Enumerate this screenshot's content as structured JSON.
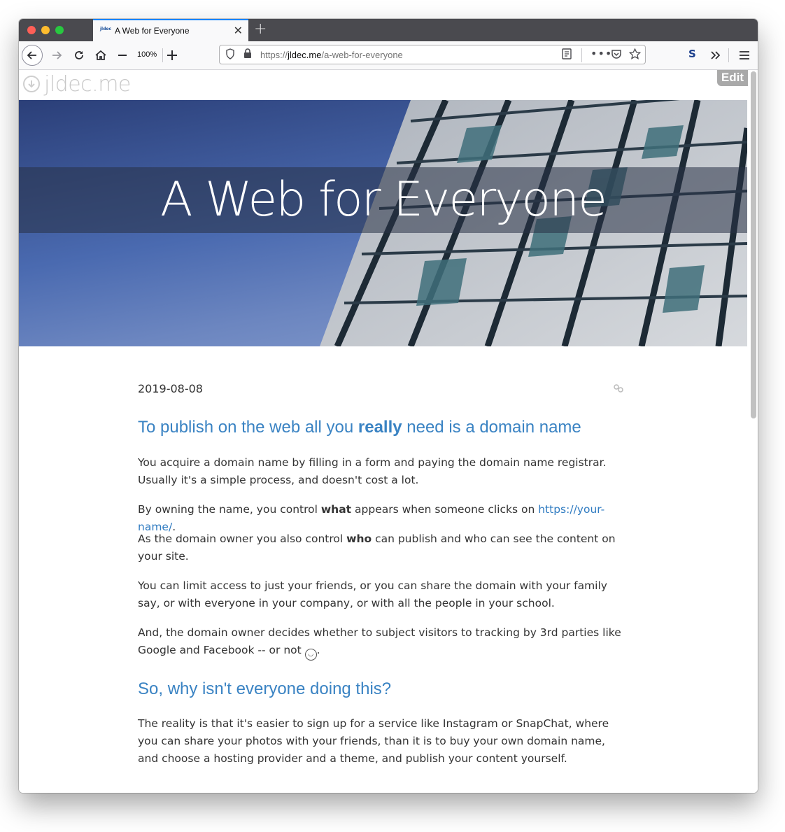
{
  "browser": {
    "tab_favicon": "jldec",
    "tab_title": "A Web for Everyone",
    "zoom": "100%",
    "url_prefix": "https://",
    "url_host": "jldec.me",
    "url_path": "/a-web-for-everyone",
    "ext_label": "S",
    "accent_color": "#0a84ff"
  },
  "site": {
    "name": "jldec.me",
    "edit_label": "Edit"
  },
  "hero": {
    "title": "A Web for Everyone"
  },
  "article": {
    "date": "2019-08-08",
    "h1_pre": "To publish on the web all you ",
    "h1_bold": "really",
    "h1_post": " need is a domain name",
    "p1": "You acquire a domain name by filling in a form and paying the domain name registrar. Usually it's a simple process, and doesn't cost a lot.",
    "p2_pre": "By owning the name, you control ",
    "p2_bold": "what",
    "p2_mid": " appears when someone clicks on ",
    "p2_link": "https://your-name/",
    "p2_post": ".",
    "p3_pre": "As the domain owner you also control ",
    "p3_bold": "who",
    "p3_post": " can publish and who can see the content on your site.",
    "p4": "You can limit access to just your friends, or you can share the domain with your family say, or with everyone in your company, or with all the people in your school.",
    "p5_pre": "And, the domain owner decides whether to subject visitors to tracking by 3rd parties like Google and Facebook -- or not ",
    "p5_post": ".",
    "h2": "So, why isn't everyone doing this?",
    "p6": "The reality is that it's easier to sign up for a service like Instagram or SnapChat, where you can share your photos with your friends, than it is to buy your own domain name, and choose a hosting provider and a theme, and publish your content yourself."
  }
}
